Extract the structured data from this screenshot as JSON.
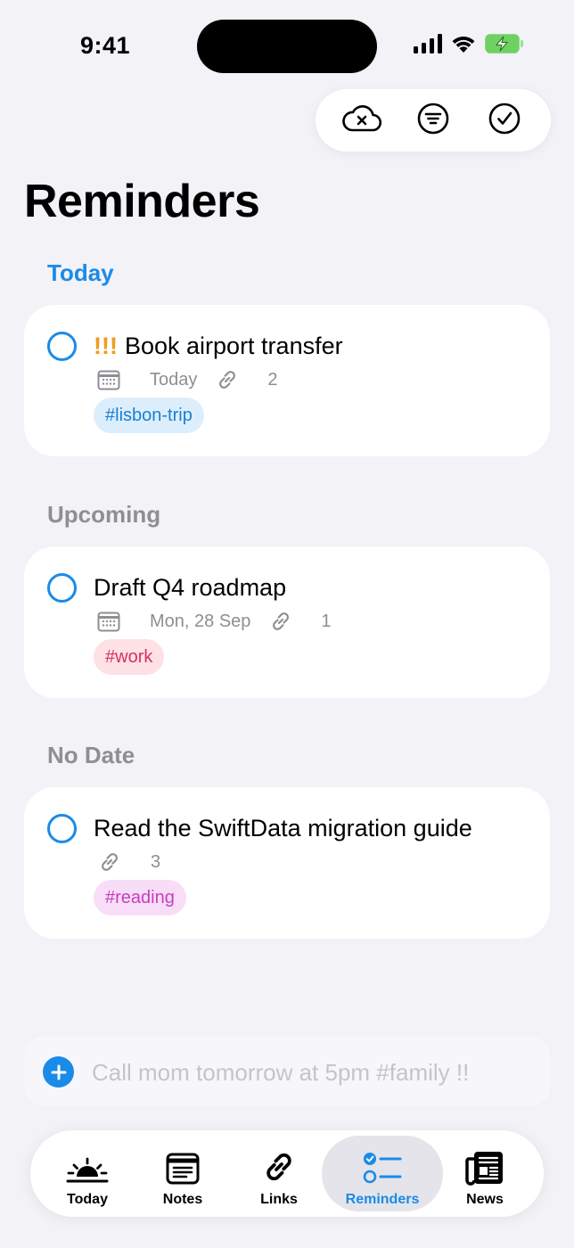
{
  "status_bar": {
    "time": "9:41"
  },
  "header": {
    "title": "Reminders",
    "actions": [
      {
        "icon": "cloud-x-icon"
      },
      {
        "icon": "filter-icon"
      },
      {
        "icon": "checkmark-circle-icon"
      }
    ]
  },
  "sections": [
    {
      "title": "Today",
      "items": [
        {
          "priority": "!!!",
          "title": "Book airport transfer",
          "date": "Today",
          "link_count": "2",
          "tag": "#lisbon-trip"
        }
      ]
    },
    {
      "title": "Upcoming",
      "items": [
        {
          "title": "Draft Q4 roadmap",
          "date": "Mon, 28 Sep",
          "link_count": "1",
          "tag": "#work"
        }
      ]
    },
    {
      "title": "No Date",
      "items": [
        {
          "title": "Read the SwiftData migration guide",
          "link_count": "3",
          "tag": "#reading"
        }
      ]
    }
  ],
  "quick_add": {
    "placeholder": "Call mom tomorrow at 5pm #family !!"
  },
  "tab_bar": {
    "tabs": [
      {
        "label": "Today",
        "icon": "sunrise-icon"
      },
      {
        "label": "Notes",
        "icon": "notes-icon"
      },
      {
        "label": "Links",
        "icon": "link-icon"
      },
      {
        "label": "Reminders",
        "icon": "checklist-icon",
        "active": true
      },
      {
        "label": "News",
        "icon": "newspaper-icon"
      }
    ]
  },
  "colors": {
    "accent": "#1a8be8",
    "background": "#f2f2f7",
    "priority": "#f29b1d",
    "tag_blue": "#1a7fd1",
    "tag_red": "#d6335a",
    "tag_purple": "#c53fc0"
  }
}
